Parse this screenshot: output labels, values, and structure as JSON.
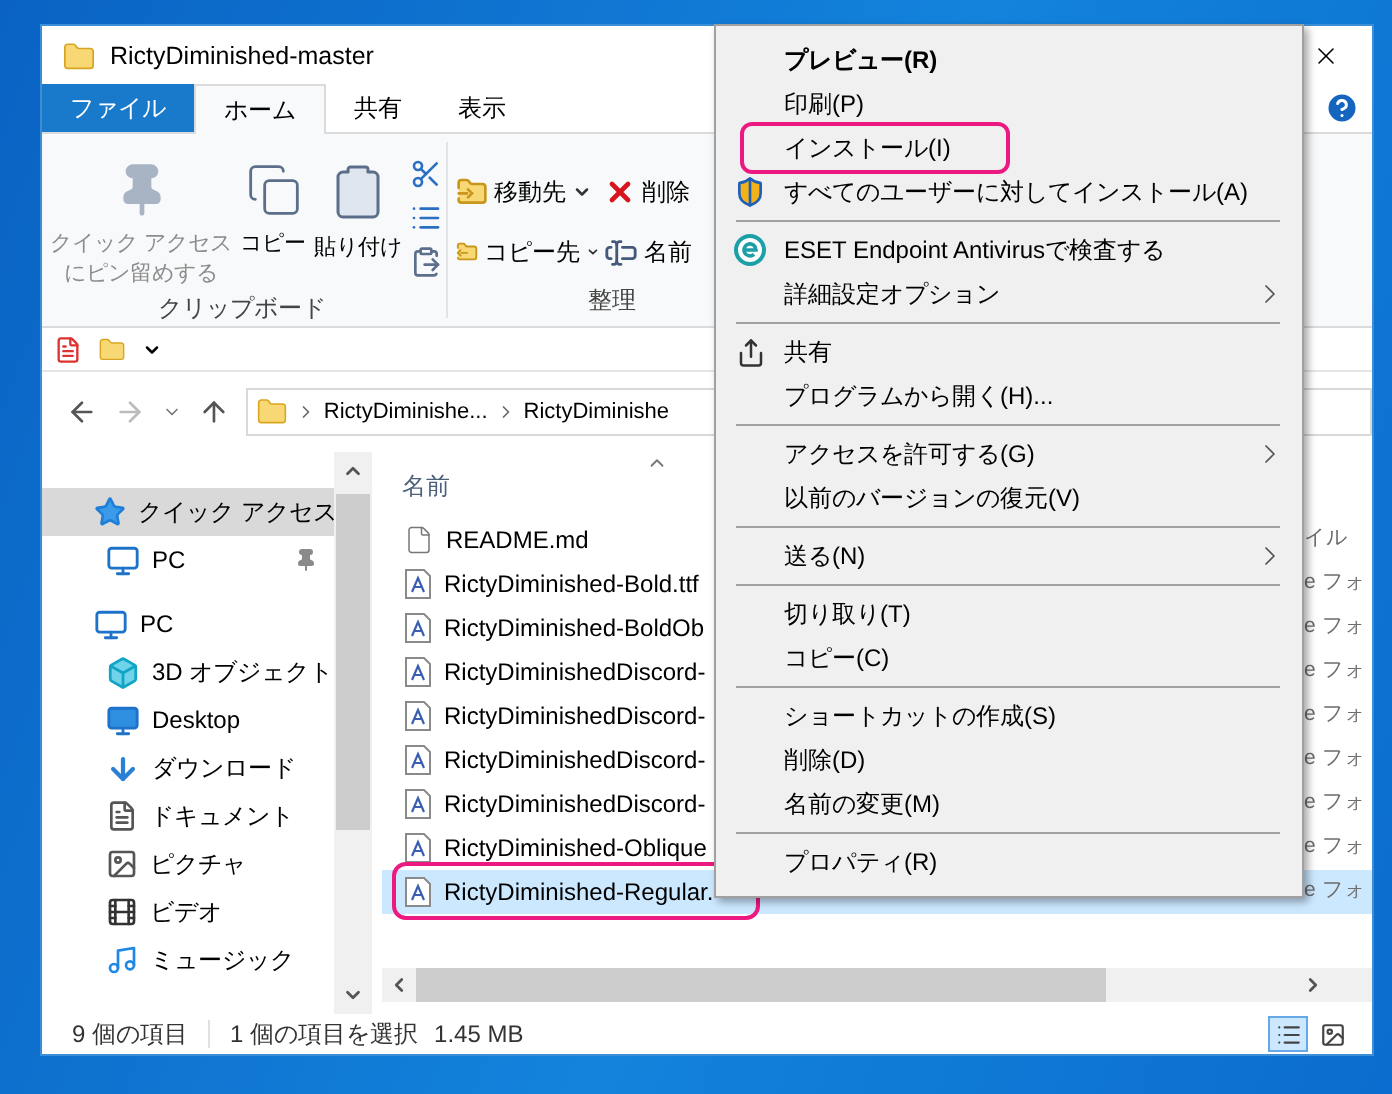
{
  "window": {
    "title": "RictyDiminished-master"
  },
  "ribbon_tabs": [
    {
      "label": "ファイル",
      "kind": "file",
      "selected": false
    },
    {
      "label": "ホーム",
      "kind": "tab",
      "selected": true
    },
    {
      "label": "共有",
      "kind": "tab",
      "selected": false
    },
    {
      "label": "表示",
      "kind": "tab",
      "selected": false
    }
  ],
  "clipboard_group": {
    "label": "クリップボード",
    "buttons": [
      {
        "lines": [
          "クイック アクセス",
          "にピン留めする"
        ],
        "disabled": true
      },
      {
        "lines": [
          "コピー"
        ],
        "disabled": false
      },
      {
        "lines": [
          "貼り付け"
        ],
        "disabled": false
      }
    ]
  },
  "organize_group": {
    "label": "整理",
    "buttons": [
      {
        "label": "移動先",
        "dropdown": true
      },
      {
        "label": "コピー先",
        "dropdown": true
      },
      {
        "label": "削除"
      },
      {
        "label": "名前"
      }
    ]
  },
  "address_bar": {
    "breadcrumbs": [
      "RictyDiminishe...",
      "RictyDiminishe"
    ]
  },
  "nav_pane": {
    "items": [
      {
        "label": "クイック アクセス",
        "selected": true,
        "children": [
          {
            "label": "PC",
            "pinned": true,
            "selected": false
          }
        ]
      },
      {
        "label": "PC",
        "selected": false,
        "children": [
          {
            "label": "3D オブジェクト",
            "selected": false
          },
          {
            "label": "Desktop",
            "selected": false
          },
          {
            "label": "ダウンロード",
            "selected": false
          },
          {
            "label": "ドキュメント",
            "selected": false
          },
          {
            "label": "ピクチャ",
            "selected": false
          },
          {
            "label": "ビデオ",
            "selected": false
          },
          {
            "label": "ミュージック",
            "selected": false
          }
        ]
      }
    ]
  },
  "file_list": {
    "columns": [
      "名前"
    ],
    "rows": [
      {
        "name": "README.md",
        "kind": "text",
        "column_2": "イル",
        "selected": false,
        "annotated": false
      },
      {
        "name": "RictyDiminished-Bold.ttf",
        "kind": "font",
        "column_2": "e フォ",
        "selected": false,
        "annotated": false
      },
      {
        "name": "RictyDiminished-BoldOb",
        "kind": "font",
        "column_2": "e フォ",
        "selected": false,
        "annotated": false
      },
      {
        "name": "RictyDiminishedDiscord-",
        "kind": "font",
        "column_2": "e フォ",
        "selected": false,
        "annotated": false
      },
      {
        "name": "RictyDiminishedDiscord-",
        "kind": "font",
        "column_2": "e フォ",
        "selected": false,
        "annotated": false
      },
      {
        "name": "RictyDiminishedDiscord-",
        "kind": "font",
        "column_2": "e フォ",
        "selected": false,
        "annotated": false
      },
      {
        "name": "RictyDiminishedDiscord-",
        "kind": "font",
        "column_2": "e フォ",
        "selected": false,
        "annotated": false
      },
      {
        "name": "RictyDiminished-Oblique",
        "kind": "font",
        "column_2": "e フォ",
        "selected": false,
        "annotated": false
      },
      {
        "name": "RictyDiminished-Regular.",
        "kind": "font",
        "column_2": "e フォ",
        "selected": true,
        "annotated": true
      }
    ]
  },
  "status_bar": {
    "item_count": "9 個の項目",
    "selection": "1 個の項目を選択",
    "size": "1.45 MB",
    "views": [
      {
        "kind": "details",
        "selected": true
      },
      {
        "kind": "large-icons",
        "selected": false
      }
    ]
  },
  "context_menu": {
    "items": [
      {
        "kind": "item",
        "label": "プレビュー(R)",
        "bold": true,
        "submenu": false,
        "annotated": false
      },
      {
        "kind": "item",
        "label": "印刷(P)",
        "bold": false,
        "submenu": false,
        "annotated": false
      },
      {
        "kind": "item",
        "label": "インストール(I)",
        "bold": false,
        "submenu": false,
        "annotated": true
      },
      {
        "kind": "item",
        "label": "すべてのユーザーに対してインストール(A)",
        "bold": false,
        "submenu": false,
        "annotated": false
      },
      {
        "kind": "separator"
      },
      {
        "kind": "item",
        "label": "ESET Endpoint Antivirusで検査する",
        "bold": false,
        "submenu": false,
        "annotated": false
      },
      {
        "kind": "item",
        "label": "詳細設定オプション",
        "bold": false,
        "submenu": true,
        "annotated": false
      },
      {
        "kind": "separator"
      },
      {
        "kind": "item",
        "label": "共有",
        "bold": false,
        "submenu": false,
        "annotated": false
      },
      {
        "kind": "item",
        "label": "プログラムから開く(H)...",
        "bold": false,
        "submenu": false,
        "annotated": false
      },
      {
        "kind": "separator"
      },
      {
        "kind": "item",
        "label": "アクセスを許可する(G)",
        "bold": false,
        "submenu": true,
        "annotated": false
      },
      {
        "kind": "item",
        "label": "以前のバージョンの復元(V)",
        "bold": false,
        "submenu": false,
        "annotated": false
      },
      {
        "kind": "separator"
      },
      {
        "kind": "item",
        "label": "送る(N)",
        "bold": false,
        "submenu": true,
        "annotated": false
      },
      {
        "kind": "separator"
      },
      {
        "kind": "item",
        "label": "切り取り(T)",
        "bold": false,
        "submenu": false,
        "annotated": false
      },
      {
        "kind": "item",
        "label": "コピー(C)",
        "bold": false,
        "submenu": false,
        "annotated": false
      },
      {
        "kind": "separator"
      },
      {
        "kind": "item",
        "label": "ショートカットの作成(S)",
        "bold": false,
        "submenu": false,
        "annotated": false
      },
      {
        "kind": "item",
        "label": "削除(D)",
        "bold": false,
        "submenu": false,
        "annotated": false
      },
      {
        "kind": "item",
        "label": "名前の変更(M)",
        "bold": false,
        "submenu": false,
        "annotated": false
      },
      {
        "kind": "separator"
      },
      {
        "kind": "item",
        "label": "プロパティ(R)",
        "bold": false,
        "submenu": false,
        "annotated": false
      }
    ]
  }
}
